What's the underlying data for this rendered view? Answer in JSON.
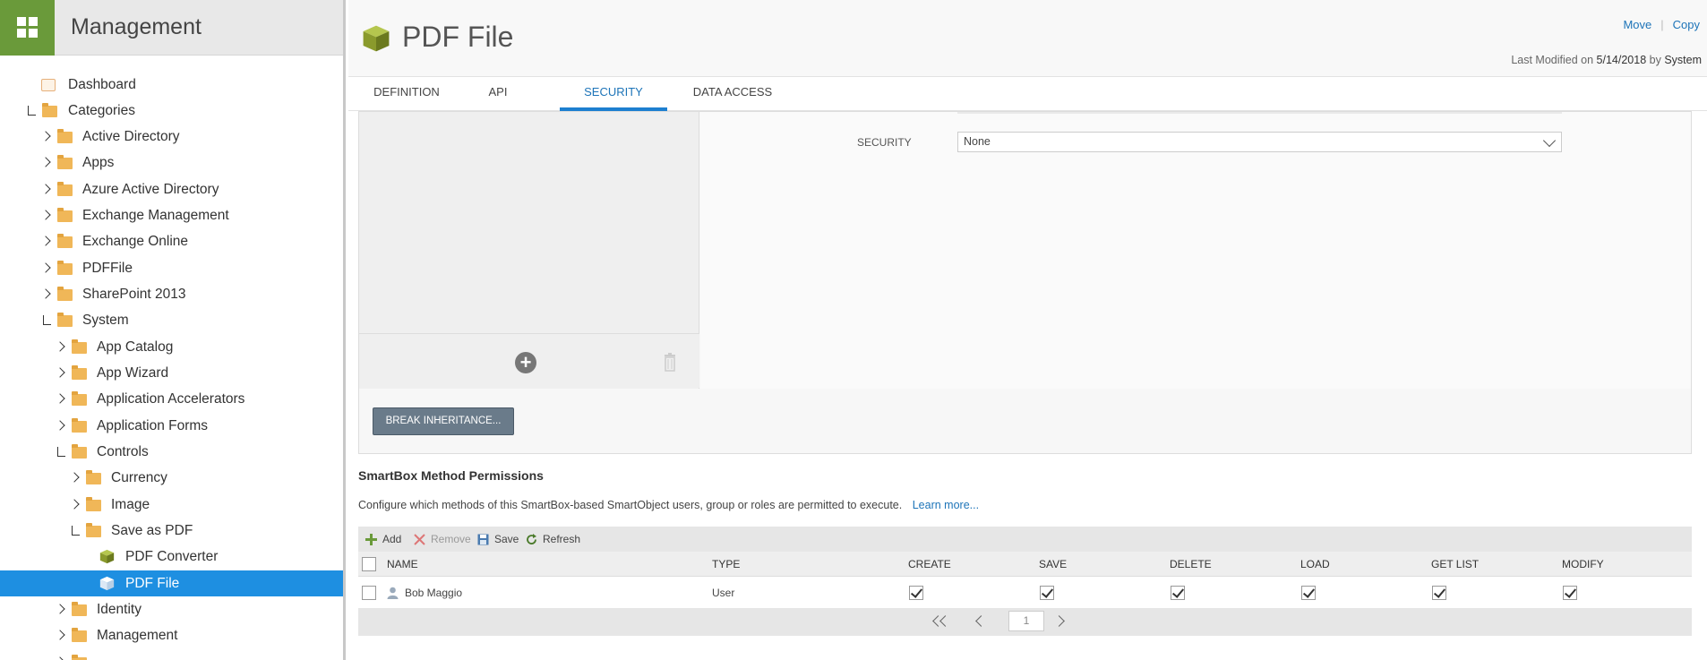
{
  "app": {
    "title": "Management"
  },
  "tree": {
    "items": [
      {
        "label": "Dashboard"
      },
      {
        "label": "Categories"
      },
      {
        "label": "Active Directory"
      },
      {
        "label": "Apps"
      },
      {
        "label": "Azure Active Directory"
      },
      {
        "label": "Exchange Management"
      },
      {
        "label": "Exchange Online"
      },
      {
        "label": "PDFFile"
      },
      {
        "label": "SharePoint 2013"
      },
      {
        "label": "System"
      },
      {
        "label": "App Catalog"
      },
      {
        "label": "App Wizard"
      },
      {
        "label": "Application Accelerators"
      },
      {
        "label": "Application Forms"
      },
      {
        "label": "Controls"
      },
      {
        "label": "Currency"
      },
      {
        "label": "Image"
      },
      {
        "label": "Save as PDF"
      },
      {
        "label": "PDF Converter"
      },
      {
        "label": "PDF File"
      },
      {
        "label": "Identity"
      },
      {
        "label": "Management"
      }
    ]
  },
  "header": {
    "title": "PDF File",
    "move_label": "Move",
    "copy_label": "Copy",
    "last_modified_prefix": "Last Modified on",
    "last_modified_date": "5/14/2018",
    "by_prefix": "by",
    "by_user": "System"
  },
  "tabs": [
    {
      "label": "DEFINITION"
    },
    {
      "label": "API"
    },
    {
      "label": "SECURITY"
    },
    {
      "label": "DATA ACCESS"
    }
  ],
  "security": {
    "label": "SECURITY",
    "value": "None",
    "break_button": "BREAK INHERITANCE..."
  },
  "smartbox": {
    "title": "SmartBox Method Permissions",
    "description": "Configure which methods of this SmartBox-based SmartObject users, group or roles are permitted to execute.",
    "learn_more": "Learn more...",
    "toolbar": {
      "add": "Add",
      "remove": "Remove",
      "save": "Save",
      "refresh": "Refresh"
    },
    "columns": [
      "NAME",
      "TYPE",
      "CREATE",
      "SAVE",
      "DELETE",
      "LOAD",
      "GET LIST",
      "MODIFY"
    ],
    "rows": [
      {
        "name": "Bob Maggio",
        "type": "User",
        "create": true,
        "save": true,
        "delete": true,
        "load": true,
        "get_list": true,
        "modify": true
      }
    ],
    "page": "1"
  },
  "colors": {
    "brand_green": "#6a9a3a",
    "selected_blue": "#1e8fe1",
    "link_blue": "#1d74b8",
    "folder": "#f0b758"
  }
}
